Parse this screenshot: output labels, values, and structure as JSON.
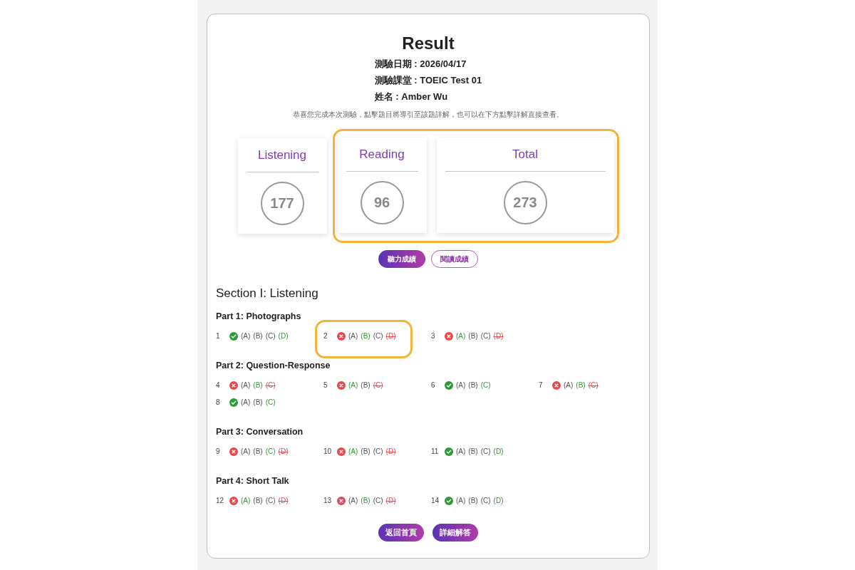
{
  "header": {
    "title": "Result",
    "info": [
      "測驗日期 : 2026/04/17",
      "測驗課堂 : TOEIC Test 01",
      "姓名 : Amber Wu"
    ],
    "note": "恭喜您完成本次測驗，點擊題目將導引至該題詳解，也可以在下方點擊詳解直接查看。"
  },
  "score_cards": [
    {
      "title": "Listening",
      "score": "177",
      "kind": "section",
      "highlighted": false
    },
    {
      "title": "Reading",
      "score": "96",
      "kind": "section",
      "highlighted": true
    },
    {
      "title": "Total",
      "score": "273",
      "kind": "total",
      "highlighted": true
    }
  ],
  "score_tabs": [
    {
      "label": "聽力成績",
      "selected": true
    },
    {
      "label": "閱讀成績",
      "selected": false
    }
  ],
  "section": {
    "title": "Section I: Listening",
    "parts": [
      {
        "title": "Part 1: Photographs",
        "questions": [
          {
            "number": "1",
            "correct": true,
            "highlighted": false,
            "choices": [
              {
                "label": "(A)",
                "kind": "plain"
              },
              {
                "label": "(B)",
                "kind": "plain"
              },
              {
                "label": "(C)",
                "kind": "plain"
              },
              {
                "label": "(D)",
                "kind": "answer"
              }
            ]
          },
          {
            "number": "2",
            "correct": false,
            "highlighted": true,
            "choices": [
              {
                "label": "(A)",
                "kind": "plain"
              },
              {
                "label": "(B)",
                "kind": "answer"
              },
              {
                "label": "(C)",
                "kind": "plain"
              },
              {
                "label": "(D)",
                "kind": "wrong"
              }
            ]
          },
          {
            "number": "3",
            "correct": false,
            "highlighted": false,
            "choices": [
              {
                "label": "(A)",
                "kind": "answer"
              },
              {
                "label": "(B)",
                "kind": "plain"
              },
              {
                "label": "(C)",
                "kind": "plain"
              },
              {
                "label": "(D)",
                "kind": "wrong"
              }
            ]
          }
        ]
      },
      {
        "title": "Part 2: Question-Response",
        "questions": [
          {
            "number": "4",
            "correct": false,
            "highlighted": false,
            "choices": [
              {
                "label": "(A)",
                "kind": "plain"
              },
              {
                "label": "(B)",
                "kind": "answer"
              },
              {
                "label": "(C)",
                "kind": "wrong"
              }
            ]
          },
          {
            "number": "5",
            "correct": false,
            "highlighted": false,
            "choices": [
              {
                "label": "(A)",
                "kind": "answer"
              },
              {
                "label": "(B)",
                "kind": "plain"
              },
              {
                "label": "(C)",
                "kind": "wrong"
              }
            ]
          },
          {
            "number": "6",
            "correct": true,
            "highlighted": false,
            "choices": [
              {
                "label": "(A)",
                "kind": "plain"
              },
              {
                "label": "(B)",
                "kind": "plain"
              },
              {
                "label": "(C)",
                "kind": "answer"
              }
            ]
          },
          {
            "number": "7",
            "correct": false,
            "highlighted": false,
            "choices": [
              {
                "label": "(A)",
                "kind": "plain"
              },
              {
                "label": "(B)",
                "kind": "answer"
              },
              {
                "label": "(C)",
                "kind": "wrong"
              }
            ]
          },
          {
            "number": "8",
            "correct": true,
            "highlighted": false,
            "choices": [
              {
                "label": "(A)",
                "kind": "plain"
              },
              {
                "label": "(B)",
                "kind": "plain"
              },
              {
                "label": "(C)",
                "kind": "answer"
              }
            ]
          }
        ]
      },
      {
        "title": "Part 3: Conversation",
        "questions": [
          {
            "number": "9",
            "correct": false,
            "highlighted": false,
            "choices": [
              {
                "label": "(A)",
                "kind": "plain"
              },
              {
                "label": "(B)",
                "kind": "plain"
              },
              {
                "label": "(C)",
                "kind": "answer"
              },
              {
                "label": "(D)",
                "kind": "wrong"
              }
            ]
          },
          {
            "number": "10",
            "correct": false,
            "highlighted": false,
            "choices": [
              {
                "label": "(A)",
                "kind": "answer"
              },
              {
                "label": "(B)",
                "kind": "plain"
              },
              {
                "label": "(C)",
                "kind": "plain"
              },
              {
                "label": "(D)",
                "kind": "wrong"
              }
            ]
          },
          {
            "number": "11",
            "correct": true,
            "highlighted": false,
            "choices": [
              {
                "label": "(A)",
                "kind": "plain"
              },
              {
                "label": "(B)",
                "kind": "plain"
              },
              {
                "label": "(C)",
                "kind": "plain"
              },
              {
                "label": "(D)",
                "kind": "answer"
              }
            ]
          }
        ]
      },
      {
        "title": "Part 4: Short Talk",
        "questions": [
          {
            "number": "12",
            "correct": false,
            "highlighted": false,
            "choices": [
              {
                "label": "(A)",
                "kind": "answer"
              },
              {
                "label": "(B)",
                "kind": "plain"
              },
              {
                "label": "(C)",
                "kind": "plain"
              },
              {
                "label": "(D)",
                "kind": "wrong"
              }
            ]
          },
          {
            "number": "13",
            "correct": false,
            "highlighted": false,
            "choices": [
              {
                "label": "(A)",
                "kind": "plain"
              },
              {
                "label": "(B)",
                "kind": "answer"
              },
              {
                "label": "(C)",
                "kind": "plain"
              },
              {
                "label": "(D)",
                "kind": "wrong"
              }
            ]
          },
          {
            "number": "14",
            "correct": true,
            "highlighted": false,
            "choices": [
              {
                "label": "(A)",
                "kind": "plain"
              },
              {
                "label": "(B)",
                "kind": "plain"
              },
              {
                "label": "(C)",
                "kind": "plain"
              },
              {
                "label": "(D)",
                "kind": "answer"
              }
            ]
          }
        ]
      }
    ]
  },
  "buttons": [
    "返回首頁",
    "詳細解答"
  ]
}
